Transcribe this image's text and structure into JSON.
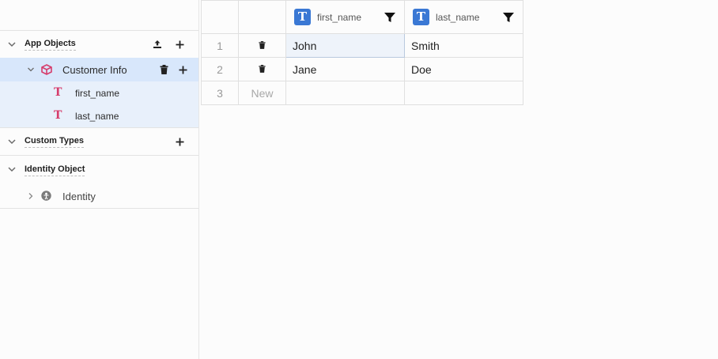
{
  "sidebar": {
    "sections": {
      "app_objects": {
        "title": "App Objects"
      },
      "custom_types": {
        "title": "Custom Types"
      },
      "identity_object": {
        "title": "Identity Object"
      }
    },
    "object": {
      "label": "Customer Info"
    },
    "fields": [
      {
        "label": "first_name",
        "icon": "text-type-icon"
      },
      {
        "label": "last_name",
        "icon": "text-type-icon"
      }
    ],
    "identity": {
      "label": "Identity"
    }
  },
  "grid": {
    "columns": [
      {
        "name": "first_name",
        "type_icon": "T"
      },
      {
        "name": "last_name",
        "type_icon": "T"
      }
    ],
    "rows": [
      {
        "num": "1",
        "first_name": "John",
        "last_name": "Smith"
      },
      {
        "num": "2",
        "first_name": "Jane",
        "last_name": "Doe"
      }
    ],
    "new_row": {
      "num": "3",
      "label": "New"
    }
  },
  "colors": {
    "accent": "#3a78d4",
    "selected_row": "#d8e7fb",
    "field_row": "#e8f0fb",
    "type_icon": "#d63c6b"
  }
}
